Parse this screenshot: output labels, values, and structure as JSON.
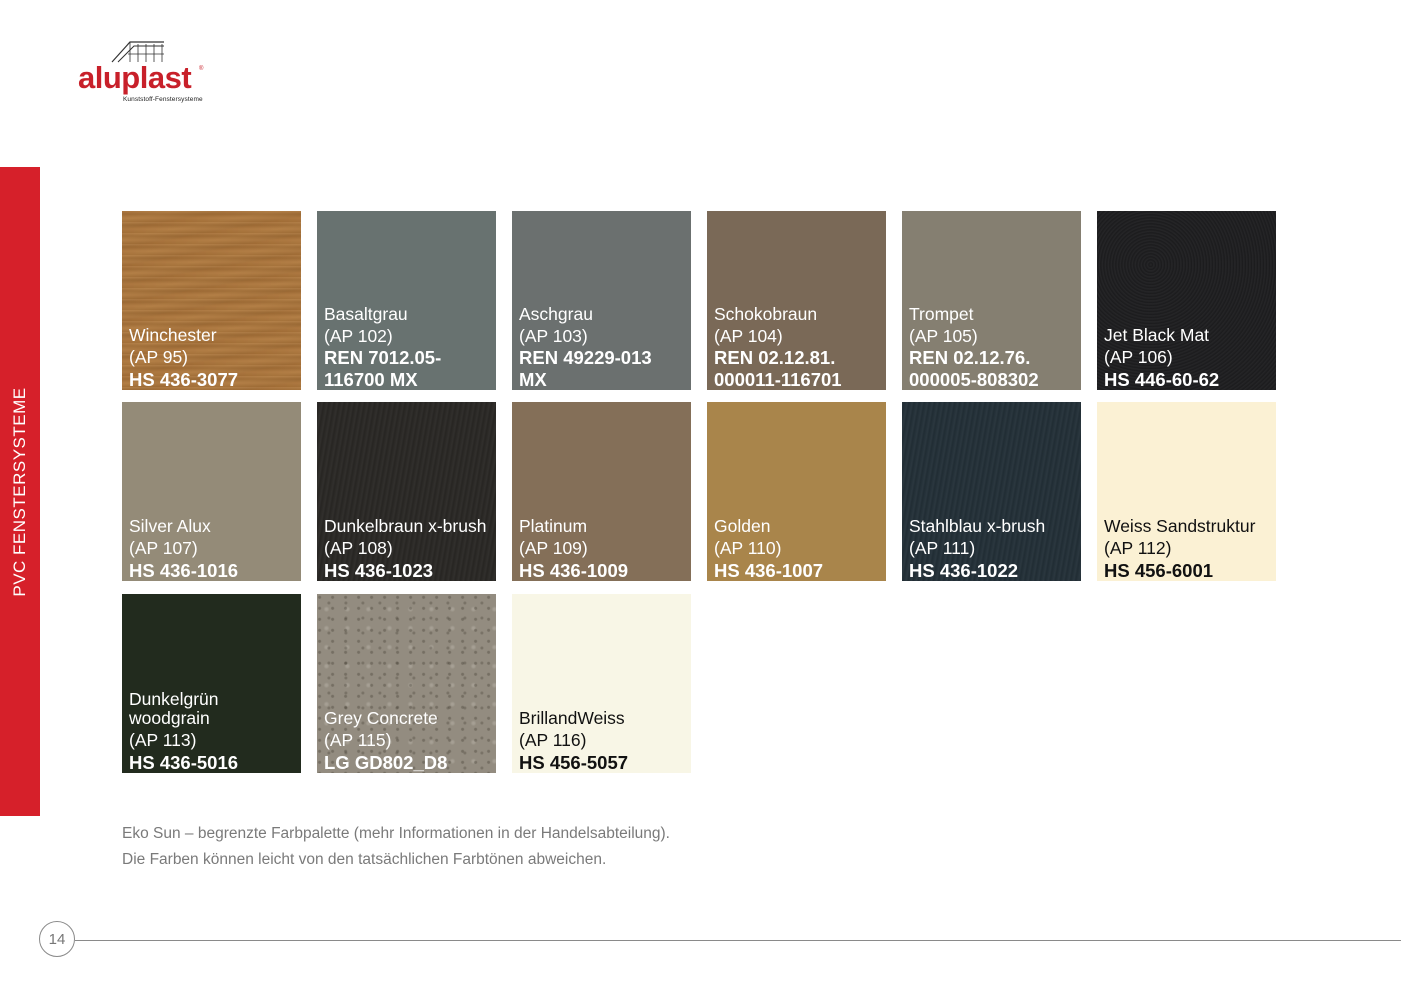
{
  "logo": {
    "brand": "aluplast",
    "registered": "®",
    "tagline": "Kunststoff-Fenstersysteme",
    "colors": {
      "brand": "#c8202a"
    }
  },
  "sidebar": {
    "label": "PVC FENSTERSYSTEME",
    "color": "#d6202a"
  },
  "swatches": [
    {
      "name": "Winchester",
      "code": "(AP 95)",
      "hs": "HS 436-3077",
      "color": "#b07a3f",
      "text_color": "#ffffff",
      "texture": "wood"
    },
    {
      "name": "Basaltgrau",
      "code": "(AP 102)",
      "hs": "REN 7012.05-\n116700 MX",
      "color": "#687270",
      "text_color": "#ffffff",
      "texture": "plain"
    },
    {
      "name": "Aschgrau",
      "code": "(AP 103)",
      "hs": "REN 49229-013\nMX",
      "color": "#6b706f",
      "text_color": "#ffffff",
      "texture": "plain"
    },
    {
      "name": "Schokobraun",
      "code": "(AP 104)",
      "hs": "REN 02.12.81.\n000011-116701",
      "color": "#7a6957",
      "text_color": "#ffffff",
      "texture": "plain"
    },
    {
      "name": "Trompet",
      "code": "(AP 105)",
      "hs": "REN 02.12.76.\n000005-808302",
      "color": "#857f71",
      "text_color": "#ffffff",
      "texture": "plain"
    },
    {
      "name": "Jet Black Mat",
      "code": "(AP 106)",
      "hs": "HS 446-60-62",
      "color": "#1e1e20",
      "text_color": "#ffffff",
      "texture": "grain"
    },
    {
      "name": "Silver Alux",
      "code": "(AP 107)",
      "hs": "HS 436-1016",
      "color": "#948b78",
      "text_color": "#ffffff",
      "texture": "plain"
    },
    {
      "name": "Dunkelbraun x-brush",
      "code": "(AP 108)",
      "hs": "HS 436-1023",
      "color": "#2a2825",
      "text_color": "#ffffff",
      "texture": "brush"
    },
    {
      "name": "Platinum",
      "code": "(AP 109)",
      "hs": "HS 436-1009",
      "color": "#846f58",
      "text_color": "#ffffff",
      "texture": "plain"
    },
    {
      "name": "Golden",
      "code": "(AP 110)",
      "hs": "HS 436-1007",
      "color": "#a9854b",
      "text_color": "#ffffff",
      "texture": "plain"
    },
    {
      "name": "Stahlblau x-brush",
      "code": "(AP 111)",
      "hs": "HS 436-1022",
      "color": "#233038",
      "text_color": "#ffffff",
      "texture": "brush"
    },
    {
      "name": "Weiss Sandstruktur",
      "code": "(AP 112)",
      "hs": "HS 456-6001",
      "color": "#fbf1d4",
      "text_color": "#111111",
      "texture": "plain"
    },
    {
      "name": "Dunkelgrün\nwoodgrain",
      "code": "(AP 113)",
      "hs": "HS 436-5016",
      "color": "#222b1e",
      "text_color": "#ffffff",
      "texture": "plain"
    },
    {
      "name": "Grey Concrete",
      "code": "(AP 115)",
      "hs": "LG GD802_D8",
      "color": "#938c80",
      "text_color": "#ffffff",
      "texture": "concrete"
    },
    {
      "name": "BrillandWeiss",
      "code": "(AP 116)",
      "hs": "HS 456-5057",
      "color": "#f8f6e6",
      "text_color": "#111111",
      "texture": "plain"
    }
  ],
  "note": {
    "line1": "Eko Sun – begrenzte Farbpalette (mehr Informationen in der Handelsabteilung).",
    "line2": "Die Farben können leicht von den tatsächlichen Farbtönen abweichen."
  },
  "footer": {
    "page_number": "14"
  }
}
